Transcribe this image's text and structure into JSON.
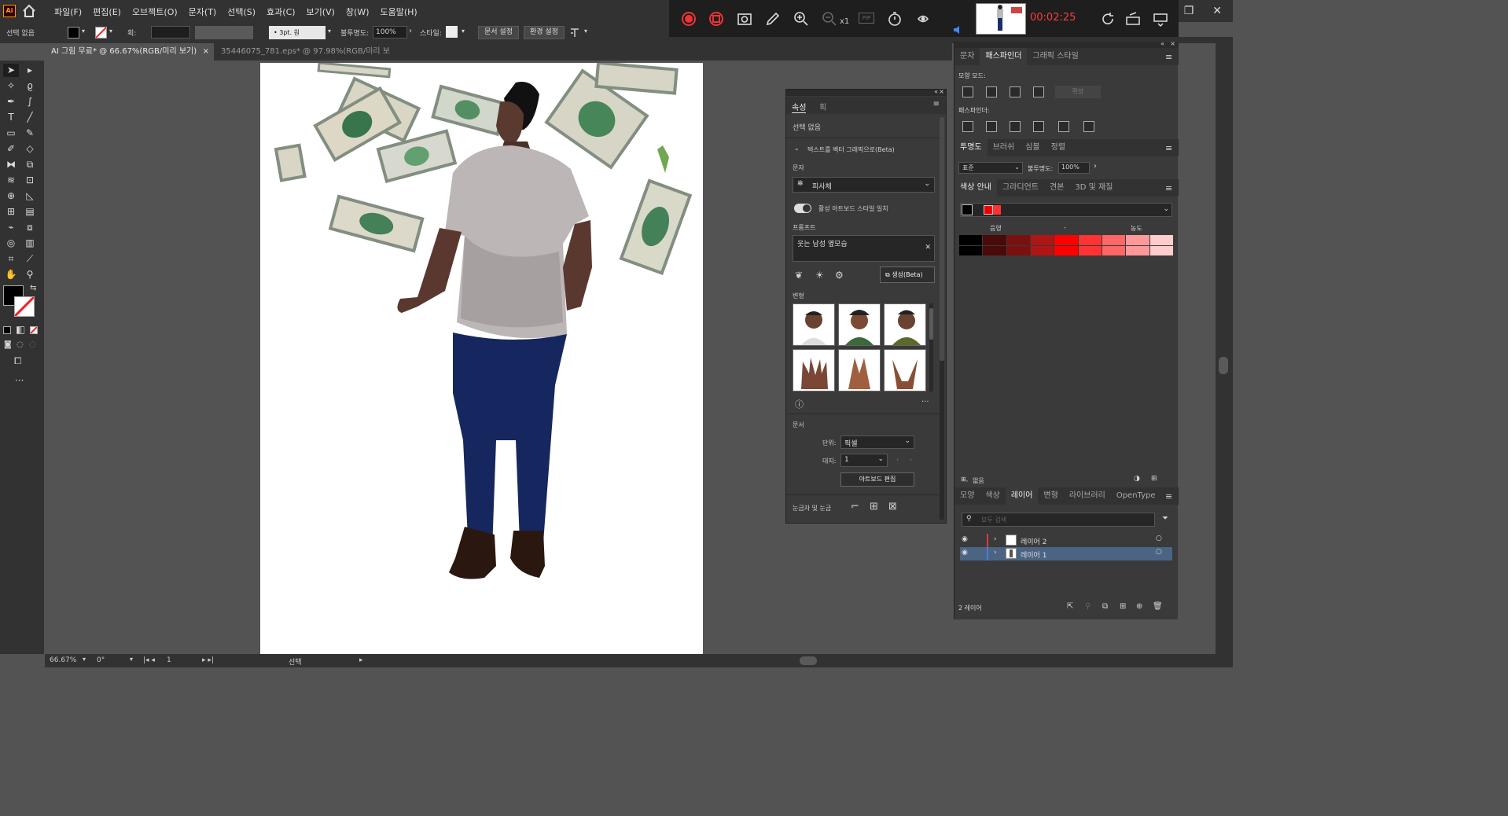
{
  "menu": {
    "logo": "Ai",
    "items": [
      "파일(F)",
      "편집(E)",
      "오브젝트(O)",
      "문자(T)",
      "선택(S)",
      "효과(C)",
      "보기(V)",
      "창(W)",
      "도움말(H)"
    ]
  },
  "recorder": {
    "time": "00:02:25",
    "zoom_label": "x1",
    "pip_label": "PIP"
  },
  "control": {
    "selection": "선택 없음",
    "stroke_label": "획:",
    "brush": "3pt. 원",
    "opacity_label": "불투명도:",
    "opacity_value": "100%",
    "style_label": "스타일:",
    "doc_setup": "문서 설정",
    "preferences": "환경 설정"
  },
  "tabs": [
    {
      "label": "AI 그림 무료* @ 66.67%(RGB/미리 보기)"
    },
    {
      "label": "35446075_781.eps* @ 97.98%(RGB/미리 보기)"
    }
  ],
  "status": {
    "zoom": "66.67%",
    "rotation": "0°",
    "artboard": "1",
    "tool": "선택"
  },
  "properties": {
    "tabs": [
      "속성",
      "획"
    ],
    "selection": "선택 없음",
    "text_to_vector": "텍스트를 벡터 그래픽으로(Beta)",
    "subject_label": "문자",
    "subject_value": "피사체",
    "artboard_style": "활성 아트보드 스타일 일치",
    "prompt_label": "프롬프트",
    "prompt_value": "웃는 남성 옆모습",
    "generate": "생성(Beta)",
    "variations_label": "변형",
    "document_label": "문서",
    "unit_label": "단위:",
    "unit_value": "픽셀",
    "artboard_label": "대지:",
    "artboard_value": "1",
    "edit_artboard": "아트보드 편집",
    "rulers_grids": "눈금자 및 눈금"
  },
  "dock": {
    "top_tabs": [
      "문자",
      "패스파인더",
      "그래픽 스타일"
    ],
    "shape_modes": "모양 모드:",
    "expand": "확장",
    "pathfinders": "패스파인더:",
    "trans_tabs": [
      "투명도",
      "브러쉬",
      "심볼",
      "정렬"
    ],
    "blend_mode": "표준",
    "opacity_label": "불투명도:",
    "opacity_value": "100%",
    "guide_tabs": [
      "색상 안내",
      "그라디언트",
      "견본",
      "3D 및 재질"
    ],
    "shade_label": "음영",
    "tint_label": "농도",
    "none_label": "없음",
    "layer_tabs": [
      "모양",
      "색상",
      "레이어",
      "변형",
      "라이브러리",
      "OpenType"
    ],
    "search_placeholder": "모두 검색",
    "layers": [
      {
        "name": "레이어 2",
        "color": "#e23b3b"
      },
      {
        "name": "레이어 1",
        "color": "#4a7bd8"
      }
    ],
    "layer_count": "2 레이어"
  },
  "colors": {
    "accent": "#ff0000",
    "shades": [
      "#000000",
      "#4a0a0a",
      "#7a1010",
      "#b01515",
      "#ff0000",
      "#ff3333",
      "#ff6666",
      "#ff9999",
      "#ffcccc"
    ]
  }
}
